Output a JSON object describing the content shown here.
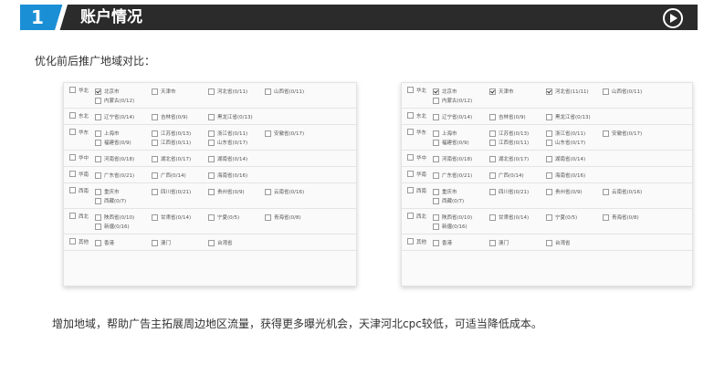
{
  "header": {
    "number": "1",
    "title": "账户情况"
  },
  "subtitle": "优化前后推广地域对比：",
  "panels": {
    "left": {
      "rows": [
        {
          "region": "华北",
          "checked": false,
          "cities": [
            {
              "name": "北京市",
              "checked": true
            },
            {
              "name": "天津市",
              "checked": false
            },
            {
              "name": "河北省(0/11)",
              "checked": false
            },
            {
              "name": "山西省(0/11)",
              "checked": false
            },
            {
              "name": "内蒙古(0/12)",
              "checked": false
            }
          ]
        },
        {
          "region": "东北",
          "checked": false,
          "cities": [
            {
              "name": "辽宁省(0/14)",
              "checked": false
            },
            {
              "name": "吉林省(0/9)",
              "checked": false
            },
            {
              "name": "黑龙江省(0/13)",
              "checked": false
            }
          ]
        },
        {
          "region": "华东",
          "checked": false,
          "cities": [
            {
              "name": "上海市",
              "checked": false
            },
            {
              "name": "江苏省(0/13)",
              "checked": false
            },
            {
              "name": "浙江省(0/11)",
              "checked": false
            },
            {
              "name": "安徽省(0/17)",
              "checked": false
            },
            {
              "name": "福建省(0/9)",
              "checked": false
            },
            {
              "name": "江西省(0/11)",
              "checked": false
            },
            {
              "name": "山东省(0/17)",
              "checked": false
            }
          ]
        },
        {
          "region": "华中",
          "checked": false,
          "cities": [
            {
              "name": "河南省(0/18)",
              "checked": false
            },
            {
              "name": "湖北省(0/17)",
              "checked": false
            },
            {
              "name": "湖南省(0/14)",
              "checked": false
            }
          ]
        },
        {
          "region": "华南",
          "checked": false,
          "cities": [
            {
              "name": "广东省(0/21)",
              "checked": false
            },
            {
              "name": "广西(0/14)",
              "checked": false
            },
            {
              "name": "海南省(0/16)",
              "checked": false
            }
          ]
        },
        {
          "region": "西南",
          "checked": false,
          "cities": [
            {
              "name": "重庆市",
              "checked": false
            },
            {
              "name": "四川省(0/21)",
              "checked": false
            },
            {
              "name": "贵州省(0/9)",
              "checked": false
            },
            {
              "name": "云南省(0/16)",
              "checked": false
            },
            {
              "name": "西藏(0/7)",
              "checked": false
            }
          ]
        },
        {
          "region": "西北",
          "checked": false,
          "cities": [
            {
              "name": "陕西省(0/10)",
              "checked": false
            },
            {
              "name": "甘肃省(0/14)",
              "checked": false
            },
            {
              "name": "宁夏(0/5)",
              "checked": false
            },
            {
              "name": "青海省(0/8)",
              "checked": false
            },
            {
              "name": "新疆(0/16)",
              "checked": false
            }
          ]
        },
        {
          "region": "其他",
          "checked": false,
          "cities": [
            {
              "name": "香港",
              "checked": false
            },
            {
              "name": "澳门",
              "checked": false
            },
            {
              "name": "台湾省",
              "checked": false
            }
          ]
        }
      ]
    },
    "right": {
      "rows": [
        {
          "region": "华北",
          "checked": false,
          "cities": [
            {
              "name": "北京市",
              "checked": true
            },
            {
              "name": "天津市",
              "checked": true
            },
            {
              "name": "河北省(11/11)",
              "checked": true
            },
            {
              "name": "山西省(0/11)",
              "checked": false
            },
            {
              "name": "内蒙古(0/12)",
              "checked": false
            }
          ]
        },
        {
          "region": "东北",
          "checked": false,
          "cities": [
            {
              "name": "辽宁省(0/14)",
              "checked": false
            },
            {
              "name": "吉林省(0/9)",
              "checked": false
            },
            {
              "name": "黑龙江省(0/13)",
              "checked": false
            }
          ]
        },
        {
          "region": "华东",
          "checked": false,
          "cities": [
            {
              "name": "上海市",
              "checked": false
            },
            {
              "name": "江苏省(0/13)",
              "checked": false
            },
            {
              "name": "浙江省(0/11)",
              "checked": false
            },
            {
              "name": "安徽省(0/17)",
              "checked": false
            },
            {
              "name": "福建省(0/9)",
              "checked": false
            },
            {
              "name": "江西省(0/11)",
              "checked": false
            },
            {
              "name": "山东省(0/17)",
              "checked": false
            }
          ]
        },
        {
          "region": "华中",
          "checked": false,
          "cities": [
            {
              "name": "河南省(0/18)",
              "checked": false
            },
            {
              "name": "湖北省(0/17)",
              "checked": false
            },
            {
              "name": "湖南省(0/14)",
              "checked": false
            }
          ]
        },
        {
          "region": "华南",
          "checked": false,
          "cities": [
            {
              "name": "广东省(0/21)",
              "checked": false
            },
            {
              "name": "广西(0/14)",
              "checked": false
            },
            {
              "name": "海南省(0/16)",
              "checked": false
            }
          ]
        },
        {
          "region": "西南",
          "checked": false,
          "cities": [
            {
              "name": "重庆市",
              "checked": false
            },
            {
              "name": "四川省(0/21)",
              "checked": false
            },
            {
              "name": "贵州省(0/9)",
              "checked": false
            },
            {
              "name": "云南省(0/16)",
              "checked": false
            },
            {
              "name": "西藏(0/7)",
              "checked": false
            }
          ]
        },
        {
          "region": "西北",
          "checked": false,
          "cities": [
            {
              "name": "陕西省(0/10)",
              "checked": false
            },
            {
              "name": "甘肃省(0/14)",
              "checked": false
            },
            {
              "name": "宁夏(0/5)",
              "checked": false
            },
            {
              "name": "青海省(0/8)",
              "checked": false
            },
            {
              "name": "新疆(0/16)",
              "checked": false
            }
          ]
        },
        {
          "region": "其他",
          "checked": false,
          "cities": [
            {
              "name": "香港",
              "checked": false
            },
            {
              "name": "澳门",
              "checked": false
            },
            {
              "name": "台湾省",
              "checked": false
            }
          ]
        }
      ]
    }
  },
  "conclusion": "增加地域，帮助广告主拓展周边地区流量，获得更多曝光机会，天津河北cpc较低，可适当降低成本。",
  "colors": {
    "accent": "#1a8fd6",
    "bar": "#2b2b2b"
  },
  "icons": {
    "header_action": "play-circle-icon"
  }
}
